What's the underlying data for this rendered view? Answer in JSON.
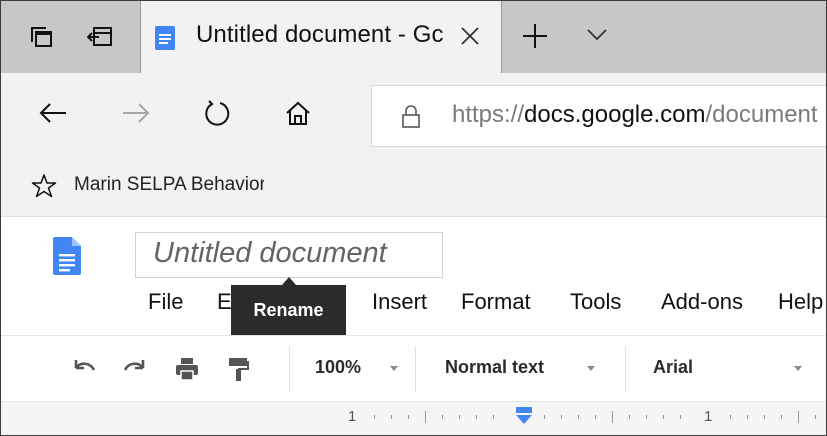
{
  "browser": {
    "tab": {
      "title": "Untitled document - Gc"
    },
    "address": {
      "scheme": "https://",
      "host": "docs.google.com",
      "path": "/document"
    },
    "favorites": [
      {
        "label": "Marin SELPA Behavior"
      }
    ]
  },
  "docs": {
    "title": "Untitled document",
    "menu": [
      "File",
      "E",
      "Insert",
      "Format",
      "Tools",
      "Add-ons",
      "Help"
    ],
    "tooltip": "Rename",
    "toolbar": {
      "zoom": "100%",
      "style": "Normal text",
      "font": "Arial"
    },
    "ruler": {
      "labels": [
        "1",
        "1"
      ]
    }
  },
  "colors": {
    "tab_bar": "#c7c7c7",
    "chrome": "#f2f2f2",
    "docs_blue": "#4285f4",
    "tooltip_bg": "#2b2b2b",
    "ruler_marker": "#4285f4"
  }
}
